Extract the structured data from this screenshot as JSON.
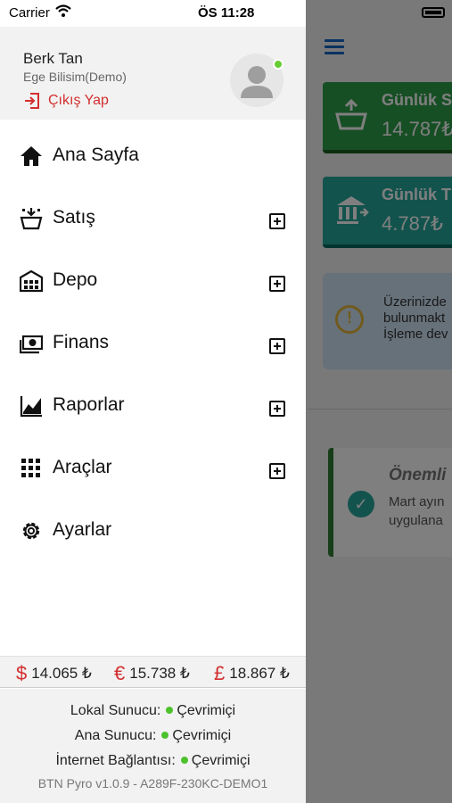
{
  "status_bar": {
    "carrier": "Carrier",
    "time": "ÖS 11:28"
  },
  "profile": {
    "name": "Berk Tan",
    "company": "Ege Bilisim(Demo)",
    "logout_label": "Çıkış Yap",
    "online": true
  },
  "menu": {
    "items": [
      {
        "label": "Ana Sayfa",
        "icon": "home-icon",
        "expandable": false
      },
      {
        "label": "Satış",
        "icon": "basket-icon",
        "expandable": true
      },
      {
        "label": "Depo",
        "icon": "warehouse-icon",
        "expandable": true
      },
      {
        "label": "Finans",
        "icon": "money-icon",
        "expandable": true
      },
      {
        "label": "Raporlar",
        "icon": "chart-icon",
        "expandable": true
      },
      {
        "label": "Araçlar",
        "icon": "grid-icon",
        "expandable": true
      },
      {
        "label": "Ayarlar",
        "icon": "gear-icon",
        "expandable": false
      }
    ]
  },
  "rates": {
    "usd": {
      "symbol": "$",
      "value": "14.065 ₺"
    },
    "eur": {
      "symbol": "€",
      "value": "15.738 ₺"
    },
    "gbp": {
      "symbol": "£",
      "value": "18.867 ₺"
    }
  },
  "server_status": {
    "local_label": "Lokal Sunucu:",
    "local_status": "Çevrimiçi",
    "main_label": "Ana Sunucu:",
    "main_status": "Çevrimiçi",
    "internet_label": "İnternet Bağlantısı:",
    "internet_status": "Çevrimiçi",
    "version": "BTN Pyro v1.0.9 - A289F-230KC-DEMO1"
  },
  "background": {
    "card1_title": "Günlük S",
    "card1_value": "14.787₺",
    "card2_title": "Günlük T",
    "card2_value": "4.787₺",
    "info_line1": "Üzerinizde",
    "info_line2": "bulunmakt",
    "info_line3": "İşleme dev",
    "note_title": "Önemli",
    "note_line1": "Mart ayın",
    "note_line2": "uygulana",
    "colors": {
      "green": "#2e9e4a",
      "teal": "#26a69a",
      "info": "#cfe3f5",
      "accent": "#1565c0"
    }
  }
}
